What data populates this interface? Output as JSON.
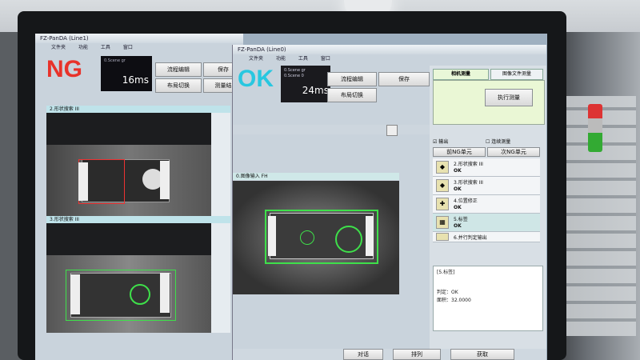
{
  "window1": {
    "title": "FZ-PanDA (Line1)",
    "menu": [
      "文件夹",
      "功能",
      "工具",
      "窗口"
    ],
    "verdict": "NG",
    "scene_text": "0.Scene gr",
    "time": "16ms",
    "buttons": [
      "流程编辑",
      "保存",
      "布局切换",
      "测量结"
    ],
    "pane1_title": "2.形状搜索 III",
    "pane2_title": "3.形状搜索 III"
  },
  "window2": {
    "title": "FZ-PanDA (Line0)",
    "menu": [
      "文件夹",
      "功能",
      "工具",
      "窗口"
    ],
    "verdict": "OK",
    "scene_text_1": "0.Scene gr",
    "scene_text_2": "0.Scene 0",
    "time": "24ms",
    "buttons": [
      "流程编辑",
      "保存",
      "布局切换"
    ],
    "image_pane_title": "0.图像输入 FH",
    "tabs": [
      "相机测量",
      "图像文件测量"
    ],
    "run_button": "执行测量",
    "checkbox_output": "输出",
    "checkbox_continuous": "连续测量",
    "unit_buttons": [
      "前NG单元",
      "次NG单元"
    ],
    "list": [
      {
        "label": "2.形状搜索 III",
        "value": "OK"
      },
      {
        "label": "3.形状搜索 III",
        "value": "OK"
      },
      {
        "label": "4.位置修正",
        "value": "OK"
      },
      {
        "label": "5.标签",
        "value": "OK"
      },
      {
        "label": "6.并行判定输出",
        "value": ""
      }
    ],
    "detail_title": "[5.标签]",
    "detail_judge_label": "判定：OK",
    "detail_area_label": "面积：32.0000",
    "bottom_buttons": [
      "对话",
      "排列",
      "获取"
    ]
  },
  "colors": {
    "ng_red": "#e8322a",
    "ok_cyan": "#28c7e0",
    "match_green": "#3ee04a"
  }
}
